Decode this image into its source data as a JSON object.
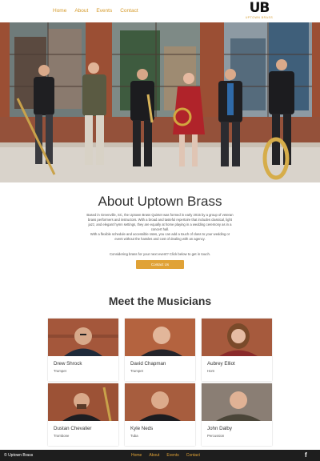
{
  "nav": {
    "items": [
      "Home",
      "About",
      "Events",
      "Contact"
    ]
  },
  "logo": {
    "mark": "UB",
    "sub": "UPTOWN BRASS"
  },
  "about": {
    "title": "About Uptown Brass",
    "paragraph1": "Based in Greenville, SC, the Uptown Brass Quintet was formed in early 2015 by a group of veteran brass performers and instructors. With a broad and tasteful repertoire that includes classical, light jazz, and elegant hymn settings, they are equally at home playing in a wedding ceremony as in a concert hall.",
    "paragraph2": "With a flexible schedule and accessible rates, you can add a touch of class to your wedding or event without the hassles and cost of dealing with an agency.",
    "cta_text": "Considering brass for your next event? Click below to get in touch.",
    "cta_button": "Contact Us"
  },
  "musicians": {
    "title": "Meet the Musicians",
    "members": [
      {
        "name": "Drew Shrock",
        "role": "Trumpet"
      },
      {
        "name": "David Chapman",
        "role": "Trumpet"
      },
      {
        "name": "Aubrey Elliot",
        "role": "Horn"
      },
      {
        "name": "Dustan Chevalier",
        "role": "Trombone"
      },
      {
        "name": "Kyle Neds",
        "role": "Tuba"
      },
      {
        "name": "John Dalby",
        "role": "Percussion"
      }
    ]
  },
  "footer": {
    "brand": "© Uptown Brass",
    "facebook_icon": "f"
  },
  "colors": {
    "accent": "#e0a236",
    "nav": "#d59a2a",
    "footer_bg": "#1e1e1e"
  }
}
